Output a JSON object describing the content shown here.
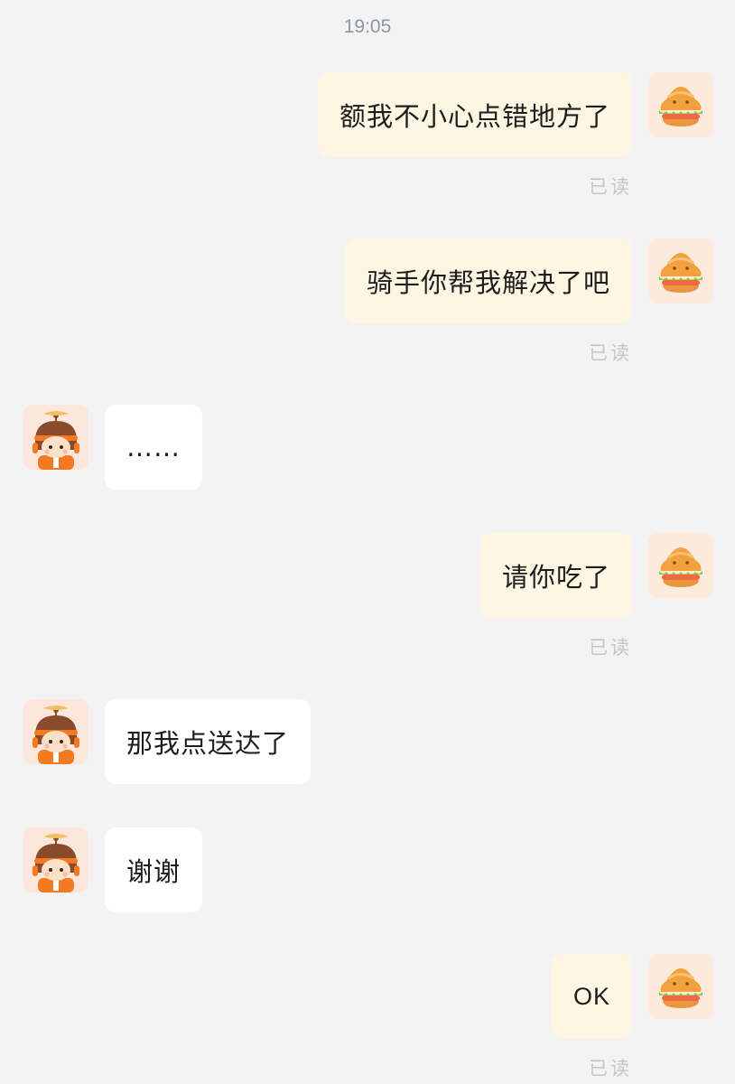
{
  "chat": {
    "timestamp": "19:05",
    "read_label": "已读",
    "messages": [
      {
        "sender": "self",
        "text": "额我不小心点错地方了",
        "read": true
      },
      {
        "sender": "self",
        "text": "骑手你帮我解决了吧",
        "read": true
      },
      {
        "sender": "rider",
        "text": "……"
      },
      {
        "sender": "self",
        "text": "请你吃了",
        "read": true
      },
      {
        "sender": "rider",
        "text": "那我点送达了"
      },
      {
        "sender": "rider",
        "text": "谢谢"
      },
      {
        "sender": "self",
        "text": "OK",
        "read": true
      }
    ]
  },
  "avatars": {
    "self_icon": "hamburger-icon",
    "rider_icon": "rider-with-helmet-icon"
  },
  "colors": {
    "background": "#f3f3f3",
    "outgoing_bubble": "#fcf6e2",
    "incoming_bubble": "#ffffff",
    "read_receipt": "#c5c5c5",
    "timestamp": "#8d97a4"
  }
}
